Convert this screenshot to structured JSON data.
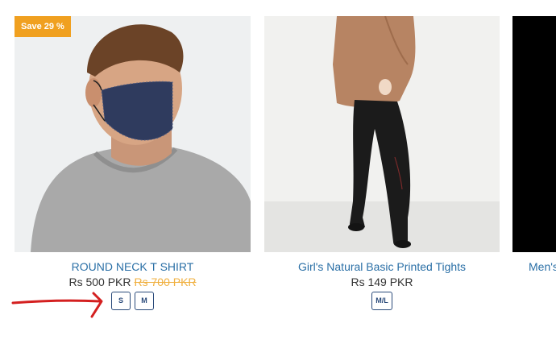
{
  "products": [
    {
      "badge": "Save 29 %",
      "title": "ROUND NECK T SHIRT",
      "price": "Rs 500 PKR",
      "old_price": "Rs 700 PKR",
      "sizes": [
        "S",
        "M"
      ]
    },
    {
      "title": "Girl's Natural Basic Printed Tights",
      "price": "Rs 149 PKR",
      "sizes": [
        "M/L"
      ]
    },
    {
      "title": "Men's"
    }
  ],
  "colors": {
    "badge": "#f0a020",
    "title_link": "#2a6fa6",
    "old_price": "#f0b040",
    "size_border": "#2a4a7a",
    "annotation": "#d42020"
  }
}
